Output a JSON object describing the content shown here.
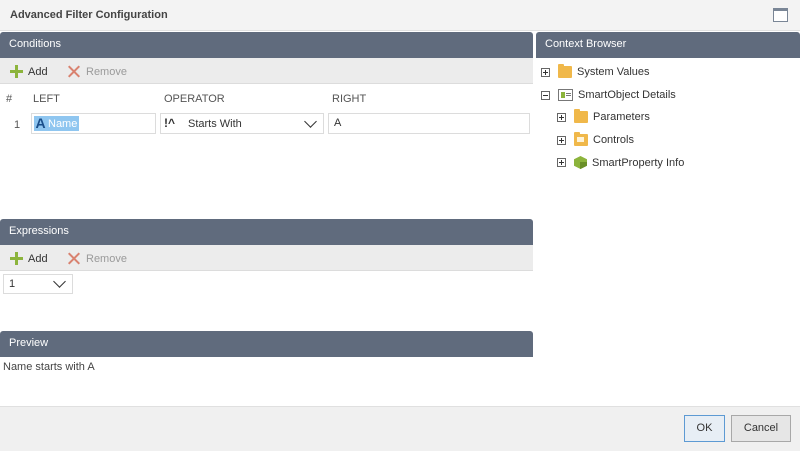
{
  "dialog": {
    "title": "Advanced Filter Configuration"
  },
  "conditions": {
    "header": "Conditions",
    "toolbar": {
      "add_label": "Add",
      "remove_label": "Remove"
    },
    "columns": [
      "#",
      "LEFT",
      "OPERATOR",
      "RIGHT"
    ],
    "rows": [
      {
        "num": "1",
        "left": "Name",
        "operator": "Starts With",
        "right": "A"
      }
    ]
  },
  "expressions": {
    "header": "Expressions",
    "toolbar": {
      "add_label": "Add",
      "remove_label": "Remove"
    },
    "selected": "1"
  },
  "preview": {
    "header": "Preview",
    "text": "Name starts with A"
  },
  "context_browser": {
    "header": "Context Browser",
    "items": [
      {
        "label": "System Values",
        "icon": "folder-icon",
        "expanded": false
      },
      {
        "label": "SmartObject Details",
        "icon": "smartobject-icon",
        "expanded": true
      },
      {
        "label": "Parameters",
        "icon": "folder-icon",
        "expanded": false
      },
      {
        "label": "Controls",
        "icon": "folder-icon",
        "expanded": false
      },
      {
        "label": "SmartProperty Info",
        "icon": "cube-icon",
        "expanded": false
      }
    ]
  },
  "footer": {
    "ok_label": "OK",
    "cancel_label": "Cancel"
  },
  "colors": {
    "header_bg": "#606b7d",
    "accent_green": "#8cb43c",
    "selection_blue": "#8fc6f0",
    "ok_border": "#5d9ad3"
  }
}
